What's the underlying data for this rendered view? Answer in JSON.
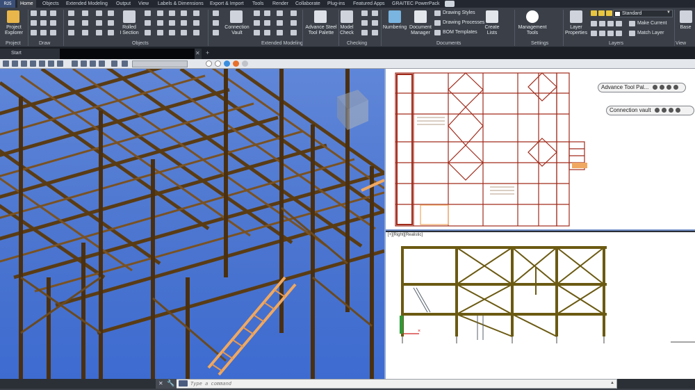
{
  "menu": {
    "app_label": "R25",
    "tabs": [
      "Home",
      "Objects",
      "Extended Modeling",
      "Output",
      "View",
      "Labels & Dimensions",
      "Export & Import",
      "Tools",
      "Render",
      "Collaborate",
      "Plug-ins",
      "Featured Apps",
      "GRAITEC PowerPack"
    ],
    "active_tab": "Home"
  },
  "ribbon": {
    "panels": {
      "project": "Project",
      "draw": "Draw",
      "objects": "Objects",
      "extended_modeling": "Extended Modeling",
      "checking": "Checking",
      "documents": "Documents",
      "settings": "Settings",
      "layers": "Layers",
      "view": "View"
    },
    "buttons": {
      "project_explorer": "Project\nExplorer",
      "rolled_i_section": "Rolled\nI Section",
      "connection_vault": "Connection\nVault",
      "advance_steel_tool_palette": "Advance Steel\nTool Palette",
      "model_check": "Model\nCheck",
      "numbering": "Numbering",
      "document_manager": "Document\nManager",
      "drawing_styles": "Drawing Styles",
      "drawing_processes": "Drawing Processes",
      "bom_templates": "BOM Templates",
      "create_lists": "Create\nLists",
      "management_tools": "Management\nTools",
      "layer_properties": "Layer\nProperties",
      "make_current": "Make Current",
      "match_layer": "Match Layer",
      "base": "Base"
    },
    "layer_current": "Standard"
  },
  "tabs": {
    "start": "Start",
    "new_tab": "+"
  },
  "viewports": {
    "bottom_right_label": "[+][Right][Realistic]"
  },
  "palettes": {
    "advance_tool_palette": "Advance Tool Pal...",
    "connection_vault": "Connection vault"
  },
  "command_line": {
    "placeholder": "Type a command"
  },
  "colors": {
    "ribbon_bg": "#3b4048",
    "menu_bg": "#232830",
    "viewport_blue": "#4a74cf",
    "steel_member": "#6b4a1e",
    "steel_member_dark": "#4a2f10",
    "drawing_red": "#a02a1a",
    "stair_orange": "#f0a860"
  }
}
